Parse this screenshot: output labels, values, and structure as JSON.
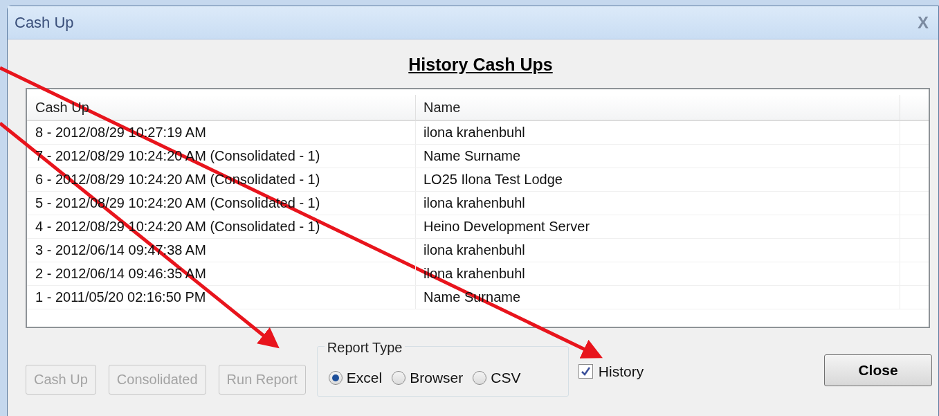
{
  "window": {
    "title": "Cash Up",
    "close": "X"
  },
  "heading": "History Cash Ups",
  "table": {
    "columns": [
      "Cash Up",
      "Name"
    ],
    "rows": [
      {
        "cash_up": "8 - 2012/08/29 10:27:19 AM",
        "name": "ilona krahenbuhl"
      },
      {
        "cash_up": "7 - 2012/08/29 10:24:20 AM (Consolidated - 1)",
        "name": "Name Surname"
      },
      {
        "cash_up": "6 - 2012/08/29 10:24:20 AM (Consolidated - 1)",
        "name": "LO25 Ilona Test Lodge"
      },
      {
        "cash_up": "5 - 2012/08/29 10:24:20 AM (Consolidated - 1)",
        "name": "ilona krahenbuhl"
      },
      {
        "cash_up": "4 - 2012/08/29 10:24:20 AM (Consolidated - 1)",
        "name": "Heino Development Server"
      },
      {
        "cash_up": "3 - 2012/06/14 09:47:38 AM",
        "name": "ilona krahenbuhl"
      },
      {
        "cash_up": "2 - 2012/06/14 09:46:35 AM",
        "name": "ilona krahenbuhl"
      },
      {
        "cash_up": "1 - 2011/05/20 02:16:50 PM",
        "name": "Name Surname"
      }
    ]
  },
  "buttons": [
    {
      "label": "Cash Up",
      "disabled": true
    },
    {
      "label": "Consolidated",
      "disabled": true
    },
    {
      "label": "Run Report",
      "disabled": true
    }
  ],
  "report_type": {
    "label": "Report Type",
    "options": [
      {
        "label": "Excel",
        "selected": true
      },
      {
        "label": "Browser",
        "selected": false
      },
      {
        "label": "CSV",
        "selected": false
      }
    ]
  },
  "history": {
    "label": "History",
    "checked": true
  },
  "close_button": "Close"
}
